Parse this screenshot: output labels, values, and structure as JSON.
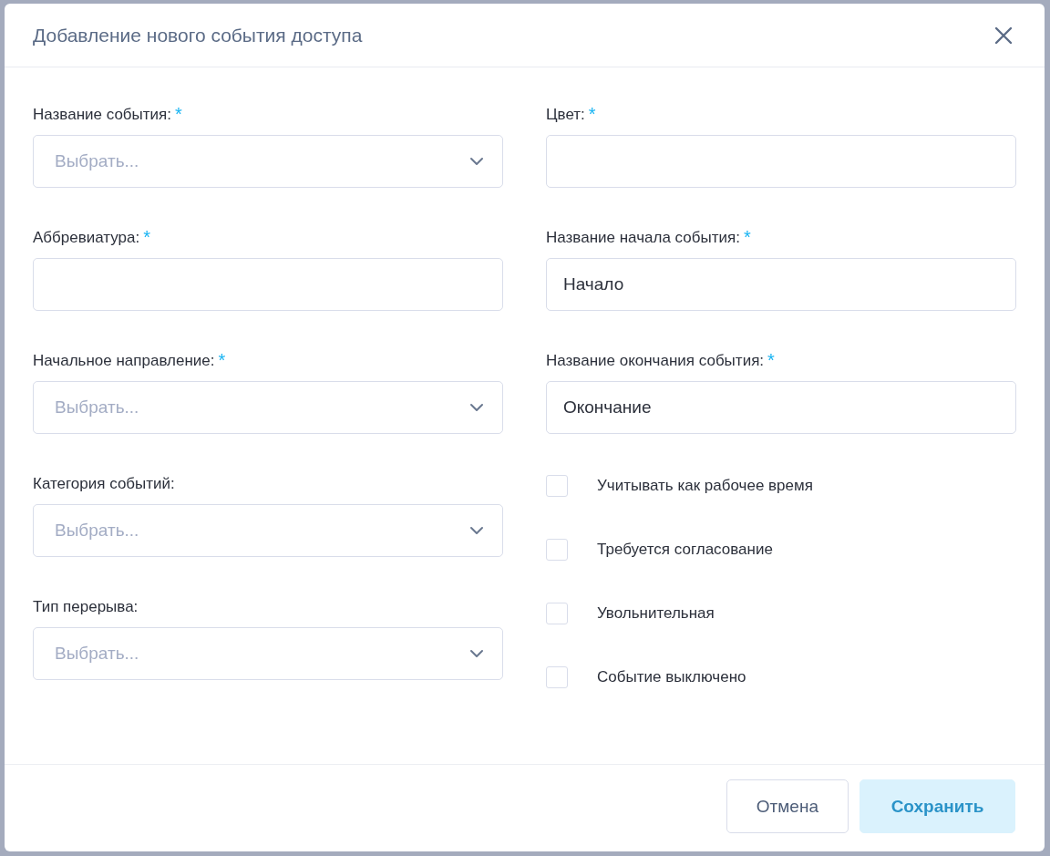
{
  "dialog": {
    "title": "Добавление нового события доступа"
  },
  "left_fields": [
    {
      "kind": "select",
      "label": "Название события:",
      "asterisk": "*",
      "placeholder": "Выбрать..."
    },
    {
      "kind": "text",
      "label": "Аббревиатура:",
      "asterisk": "*"
    },
    {
      "kind": "select",
      "label": "Начальное направление:",
      "asterisk": "*",
      "placeholder": "Выбрать..."
    },
    {
      "kind": "select",
      "label": "Категория событий:",
      "placeholder": "Выбрать..."
    },
    {
      "kind": "select",
      "label": "Тип перерыва:",
      "placeholder": "Выбрать..."
    }
  ],
  "right_fields": [
    {
      "kind": "text",
      "label": "Цвет:",
      "asterisk": "*"
    },
    {
      "kind": "text",
      "label": "Название начала события:",
      "asterisk": "*",
      "value": "Начало"
    },
    {
      "kind": "text",
      "label": "Название окончания события:",
      "asterisk": "*",
      "value": "Окончание"
    }
  ],
  "checkboxes": [
    {
      "label": "Учитывать как рабочее время",
      "checked": false
    },
    {
      "label": "Требуется согласование",
      "checked": false
    },
    {
      "label": "Увольнительная",
      "checked": false
    },
    {
      "label": "Событие выключено",
      "checked": false
    }
  ],
  "buttons": [
    {
      "kind": "secondary",
      "label": "Отмена"
    },
    {
      "kind": "primary",
      "label": "Сохранить",
      "disabled": true
    }
  ]
}
